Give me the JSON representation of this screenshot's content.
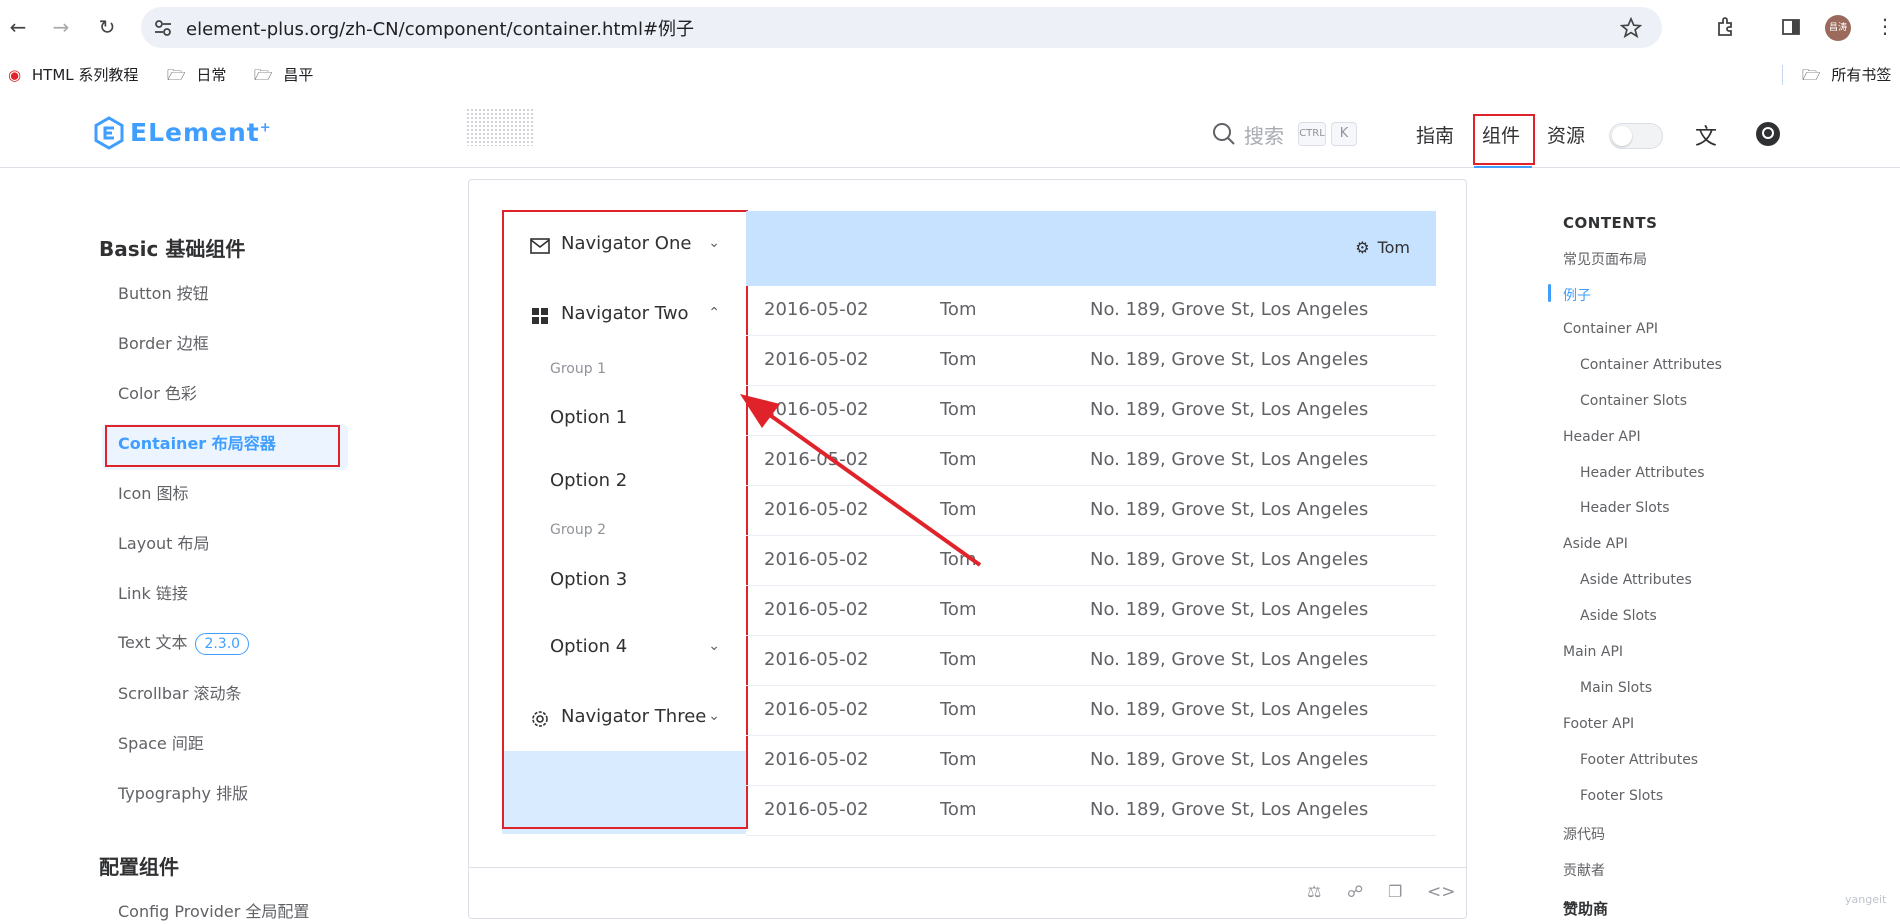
{
  "browser": {
    "url": "element-plus.org/zh-CN/component/container.html#例子",
    "bookmarks": [
      "HTML 系列教程",
      "日常",
      "昌平"
    ],
    "all_bookmarks": "所有书签",
    "avatar_text": "昌涛"
  },
  "header": {
    "logo": "ELement",
    "logo_sup": "+",
    "search_label": "搜索",
    "kbd_ctrl": "CTRL",
    "kbd_k": "K",
    "nav": [
      "指南",
      "组件",
      "资源"
    ]
  },
  "sidebar": {
    "group1": "Basic 基础组件",
    "items": [
      "Button 按钮",
      "Border 边框",
      "Color 色彩",
      "Container 布局容器",
      "Icon 图标",
      "Layout 布局",
      "Link 链接",
      "Text 文本",
      "Scrollbar 滚动条",
      "Space 间距",
      "Typography 排版"
    ],
    "text_tag": "2.3.0",
    "group2": "配置组件",
    "config_item": "Config Provider 全局配置"
  },
  "demo": {
    "menu": {
      "nav1": "Navigator One",
      "nav2": "Navigator Two",
      "group1": "Group 1",
      "option1": "Option 1",
      "option2": "Option 2",
      "group2": "Group 2",
      "option3": "Option 3",
      "option4": "Option 4",
      "nav3": "Navigator Three"
    },
    "header_user": "Tom",
    "rows": [
      {
        "date": "2016-05-02",
        "name": "Tom",
        "address": "No. 189, Grove St, Los Angeles"
      },
      {
        "date": "2016-05-02",
        "name": "Tom",
        "address": "No. 189, Grove St, Los Angeles"
      },
      {
        "date": "2016-05-02",
        "name": "Tom",
        "address": "No. 189, Grove St, Los Angeles"
      },
      {
        "date": "2016-05-02",
        "name": "Tom",
        "address": "No. 189, Grove St, Los Angeles"
      },
      {
        "date": "2016-05-02",
        "name": "Tom",
        "address": "No. 189, Grove St, Los Angeles"
      },
      {
        "date": "2016-05-02",
        "name": "Tom",
        "address": "No. 189, Grove St, Los Angeles"
      },
      {
        "date": "2016-05-02",
        "name": "Tom",
        "address": "No. 189, Grove St, Los Angeles"
      },
      {
        "date": "2016-05-02",
        "name": "Tom",
        "address": "No. 189, Grove St, Los Angeles"
      },
      {
        "date": "2016-05-02",
        "name": "Tom",
        "address": "No. 189, Grove St, Los Angeles"
      },
      {
        "date": "2016-05-02",
        "name": "Tom",
        "address": "No. 189, Grove St, Los Angeles"
      },
      {
        "date": "2016-05-02",
        "name": "Tom",
        "address": "No. 189, Grove St, Los Angeles"
      }
    ]
  },
  "toc": {
    "title": "CONTENTS",
    "items": [
      "常见页面布局",
      "例子",
      "Container API",
      "Container Attributes",
      "Container Slots",
      "Header API",
      "Header Attributes",
      "Header Slots",
      "Aside API",
      "Aside Attributes",
      "Aside Slots",
      "Main API",
      "Main Slots",
      "Footer API",
      "Footer Attributes",
      "Footer Slots",
      "源代码",
      "贡献者",
      "赞助商"
    ]
  },
  "watermark": "yangeit",
  "colors": {
    "primary": "#409eff",
    "annotation_red": "#e0232a",
    "header_bg": "#c6e2ff",
    "aside_bg": "#d9ecff"
  }
}
